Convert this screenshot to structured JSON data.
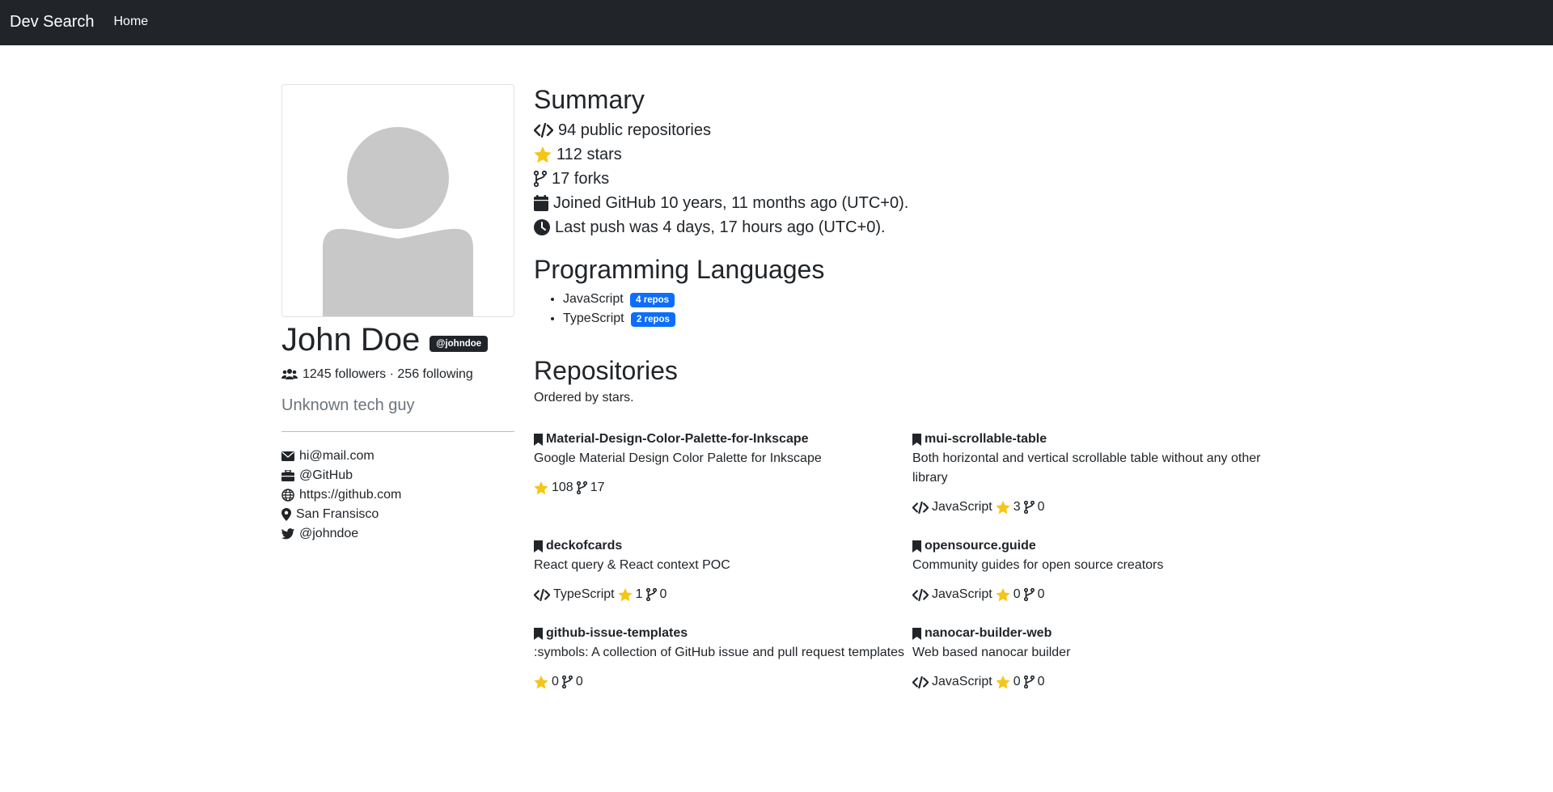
{
  "nav": {
    "brand": "Dev Search",
    "home": "Home"
  },
  "profile": {
    "name": "John Doe",
    "handle": "@johndoe",
    "followers_text": "1245 followers · 256 following",
    "bio": "Unknown tech guy",
    "contacts": [
      {
        "icon": "envelope-icon",
        "text": "hi@mail.com"
      },
      {
        "icon": "briefcase-icon",
        "text": "@GitHub"
      },
      {
        "icon": "globe-icon",
        "text": "https://github.com"
      },
      {
        "icon": "location-icon",
        "text": "San Fransisco"
      },
      {
        "icon": "twitter-icon",
        "text": "@johndoe"
      }
    ]
  },
  "summary": {
    "title": "Summary",
    "items": [
      {
        "icon": "code-icon",
        "text": "94 public repositories"
      },
      {
        "icon": "star-icon",
        "text": "112 stars"
      },
      {
        "icon": "fork-icon",
        "text": "17 forks"
      },
      {
        "icon": "calendar-icon",
        "text": "Joined GitHub 10 years, 11 months ago (UTC+0)."
      },
      {
        "icon": "clock-icon",
        "text": "Last push was 4 days, 17 hours ago (UTC+0)."
      }
    ]
  },
  "languages": {
    "title": "Programming Languages",
    "items": [
      {
        "name": "JavaScript",
        "badge": "4 repos"
      },
      {
        "name": "TypeScript",
        "badge": "2 repos"
      }
    ]
  },
  "repositories": {
    "title": "Repositories",
    "subtitle": "Ordered by stars.",
    "items": [
      {
        "name": "Material-Design-Color-Palette-for-Inkscape",
        "description": "Google Material Design Color Palette for Inkscape",
        "language": "",
        "stars": "108",
        "forks": "17"
      },
      {
        "name": "mui-scrollable-table",
        "description": "Both horizontal and vertical scrollable table without any other library",
        "language": "JavaScript",
        "stars": "3",
        "forks": "0"
      },
      {
        "name": "deckofcards",
        "description": "React query & React context POC",
        "language": "TypeScript",
        "stars": "1",
        "forks": "0"
      },
      {
        "name": "opensource.guide",
        "description": "Community guides for open source creators",
        "language": "JavaScript",
        "stars": "0",
        "forks": "0"
      },
      {
        "name": "github-issue-templates",
        "description": ":symbols: A collection of GitHub issue and pull request templates",
        "language": "",
        "stars": "0",
        "forks": "0"
      },
      {
        "name": "nanocar-builder-web",
        "description": "Web based nanocar builder",
        "language": "JavaScript",
        "stars": "0",
        "forks": "0"
      }
    ]
  },
  "colors": {
    "navbar": "#212529",
    "accent_badge": "#0d6efd",
    "star": "#f5c518",
    "avatar_gray": "#c8c8c8"
  }
}
